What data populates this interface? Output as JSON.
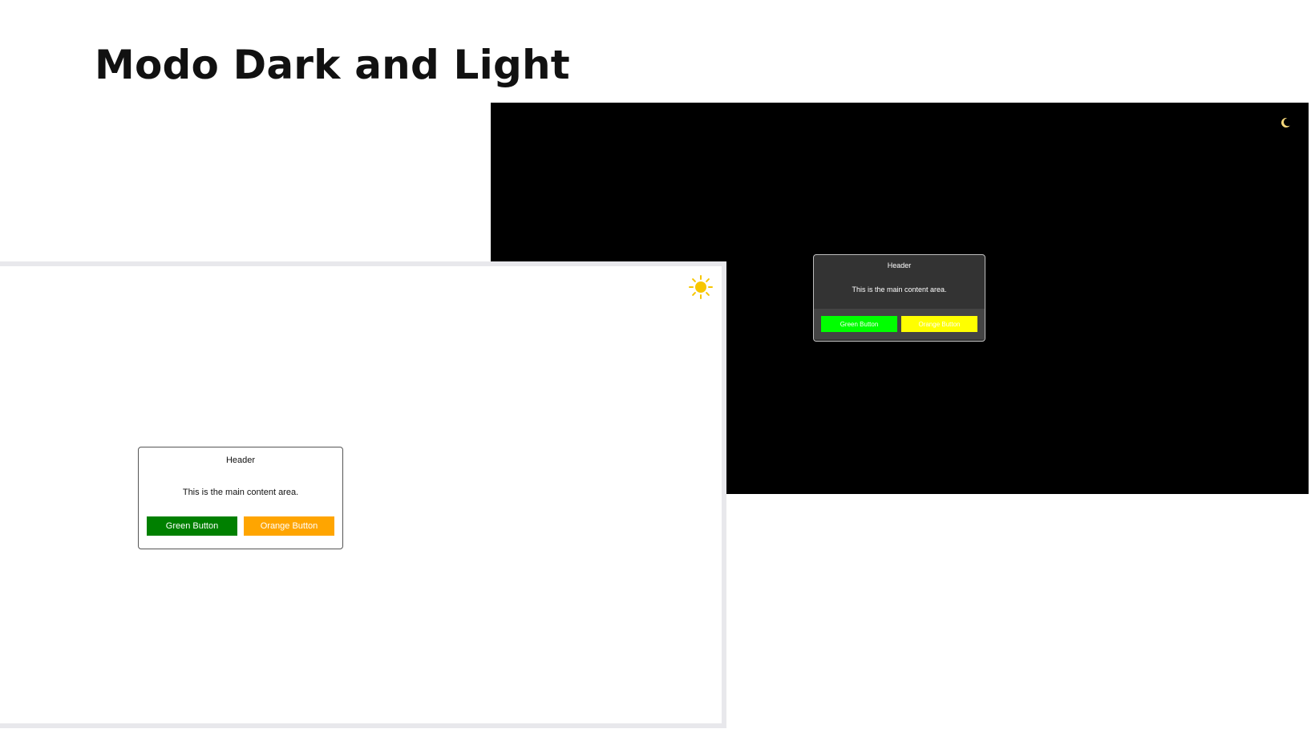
{
  "slide": {
    "title": "Modo Dark and Light"
  },
  "dark_mode": {
    "background": "#000000",
    "toggle_icon": "moon-icon",
    "card": {
      "header": "Header",
      "body": "This is the main content area.",
      "green_button": "Green Button",
      "orange_button": "Orange Button",
      "colors": {
        "card": "#333333",
        "footer": "#444444",
        "green": "#00ff00",
        "orange": "#ffff00"
      }
    }
  },
  "light_mode": {
    "background": "#ffffff",
    "toggle_icon": "sun-icon",
    "card": {
      "header": "Header",
      "body": "This is the main content area.",
      "green_button": "Green Button",
      "orange_button": "Orange Button",
      "colors": {
        "card": "#ffffff",
        "green": "#008000",
        "orange": "#ffa500"
      }
    }
  }
}
